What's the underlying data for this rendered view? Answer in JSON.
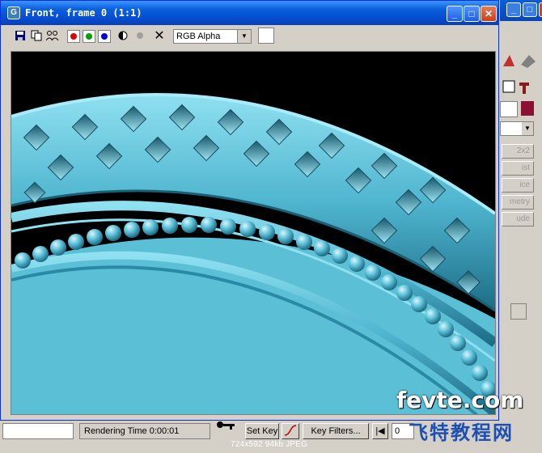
{
  "window": {
    "title": "Front, frame 0 (1:1)",
    "icon_letter": "G",
    "minimize_glyph": "_",
    "maximize_glyph": "□",
    "close_glyph": "✕"
  },
  "toolbar": {
    "channel_select_value": "RGB Alpha",
    "channel_colors": {
      "red": "#e00000",
      "green": "#00a000",
      "blue": "#0000e0"
    },
    "icons": [
      "save-icon",
      "copy-icon",
      "clone-icon",
      "red-channel-icon",
      "green-channel-icon",
      "blue-channel-icon",
      "mono-icon",
      "gray-dot-icon",
      "clear-icon"
    ]
  },
  "side_panel": {
    "items": [
      "2x2",
      "ist",
      "ice",
      "metry",
      "ude"
    ]
  },
  "status": {
    "rendering_time_label": "Rendering Time",
    "rendering_time_value": "0:00:01",
    "set_key_label": "Set Key",
    "key_filters_label": "Key Filters...",
    "frame_value": "0"
  },
  "image_caption": "724x592  94kb  JPEG",
  "watermark": {
    "line1": "fevte.com",
    "line2": "飞特教程网"
  },
  "colors": {
    "title_bar": "#0a5fdc",
    "ring": "#5ec3dc",
    "ring_dark": "#2a8aa6",
    "floor": "#5bbfd6",
    "watermark_blue": "#1e4fb3"
  }
}
